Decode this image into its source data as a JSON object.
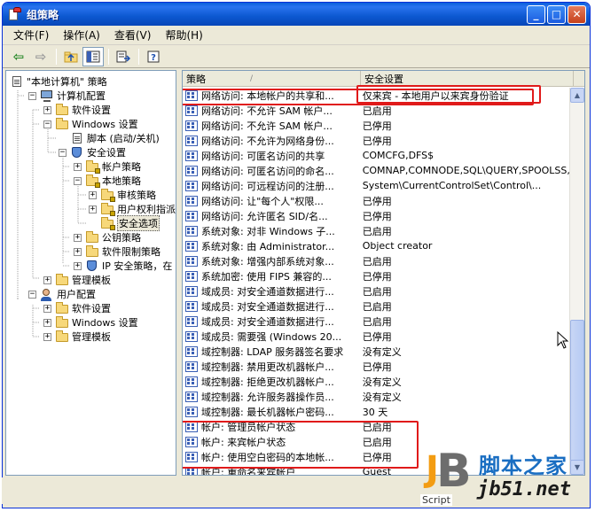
{
  "window": {
    "title": "组策略",
    "buttons": {
      "minimize": "_",
      "maximize": "□",
      "close": "✕"
    }
  },
  "menubar": {
    "items": [
      {
        "label": "文件(F)"
      },
      {
        "label": "操作(A)"
      },
      {
        "label": "查看(V)"
      },
      {
        "label": "帮助(H)"
      }
    ]
  },
  "toolbar": {
    "back_icon": "arrow-left-icon",
    "forward_icon": "arrow-right-icon",
    "up_icon": "up-folder-icon",
    "show_hide_tree_icon": "tree-toggle-icon",
    "export_icon": "export-list-icon",
    "help_icon": "help-icon"
  },
  "tree": {
    "items": [
      {
        "label": "\"本地计算机\" 策略",
        "icon": "policy-icon",
        "expander": "",
        "indent": 0
      },
      {
        "label": "计算机配置",
        "icon": "computer-icon",
        "expander": "−",
        "indent": 1
      },
      {
        "label": "软件设置",
        "icon": "folder-icon",
        "expander": "+",
        "indent": 2
      },
      {
        "label": "Windows 设置",
        "icon": "folder-icon",
        "expander": "−",
        "indent": 2
      },
      {
        "label": "脚本 (启动/关机)",
        "icon": "script-icon",
        "expander": "",
        "indent": 3
      },
      {
        "label": "安全设置",
        "icon": "shield-icon",
        "expander": "−",
        "indent": 3
      },
      {
        "label": "帐户策略",
        "icon": "locked-folder-icon",
        "expander": "+",
        "indent": 4
      },
      {
        "label": "本地策略",
        "icon": "locked-folder-icon",
        "expander": "−",
        "indent": 4
      },
      {
        "label": "审核策略",
        "icon": "locked-folder-icon",
        "expander": "+",
        "indent": 5
      },
      {
        "label": "用户权利指派",
        "icon": "locked-folder-icon",
        "expander": "+",
        "indent": 5
      },
      {
        "label": "安全选项",
        "icon": "locked-folder-icon",
        "expander": "",
        "indent": 5,
        "selected": true
      },
      {
        "label": "公钥策略",
        "icon": "folder-icon",
        "expander": "+",
        "indent": 4
      },
      {
        "label": "软件限制策略",
        "icon": "folder-icon",
        "expander": "+",
        "indent": 4
      },
      {
        "label": "IP 安全策略，在",
        "icon": "ip-security-icon",
        "expander": "+",
        "indent": 4
      },
      {
        "label": "管理模板",
        "icon": "folder-icon",
        "expander": "+",
        "indent": 2
      },
      {
        "label": "用户配置",
        "icon": "user-icon",
        "expander": "−",
        "indent": 1
      },
      {
        "label": "软件设置",
        "icon": "folder-icon",
        "expander": "+",
        "indent": 2
      },
      {
        "label": "Windows 设置",
        "icon": "folder-icon",
        "expander": "+",
        "indent": 2
      },
      {
        "label": "管理模板",
        "icon": "folder-icon",
        "expander": "+",
        "indent": 2
      }
    ]
  },
  "list": {
    "columns": [
      {
        "label": "策略",
        "sort": "/"
      },
      {
        "label": "安全设置"
      }
    ],
    "rows": [
      {
        "policy": "网络访问: 本地帐户的共享和...",
        "setting": "仅来宾 - 本地用户以来宾身份验证"
      },
      {
        "policy": "网络访问: 不允许 SAM 帐户...",
        "setting": "已启用"
      },
      {
        "policy": "网络访问: 不允许 SAM 帐户...",
        "setting": "已停用"
      },
      {
        "policy": "网络访问: 不允许为网络身份...",
        "setting": "已停用"
      },
      {
        "policy": "网络访问: 可匿名访问的共享",
        "setting": "COMCFG,DFS$"
      },
      {
        "policy": "网络访问: 可匿名访问的命名...",
        "setting": "COMNAP,COMNODE,SQL\\QUERY,SPOOLSS,..."
      },
      {
        "policy": "网络访问: 可远程访问的注册...",
        "setting": "System\\CurrentControlSet\\Control\\..."
      },
      {
        "policy": "网络访问: 让\"每个人\"权限...",
        "setting": "已停用"
      },
      {
        "policy": "网络访问: 允许匿名 SID/名...",
        "setting": "已停用"
      },
      {
        "policy": "系统对象: 对非 Windows 子...",
        "setting": "已启用"
      },
      {
        "policy": "系统对象: 由 Administrator...",
        "setting": "Object creator"
      },
      {
        "policy": "系统对象: 增强内部系统对象...",
        "setting": "已启用"
      },
      {
        "policy": "系统加密: 使用 FIPS 兼容的...",
        "setting": "已停用"
      },
      {
        "policy": "域成员: 对安全通道数据进行...",
        "setting": "已启用"
      },
      {
        "policy": "域成员: 对安全通道数据进行...",
        "setting": "已启用"
      },
      {
        "policy": "域成员: 对安全通道数据进行...",
        "setting": "已启用"
      },
      {
        "policy": "域成员: 需要强 (Windows 20...",
        "setting": "已停用"
      },
      {
        "policy": "域控制器: LDAP 服务器签名要求",
        "setting": "没有定义"
      },
      {
        "policy": "域控制器: 禁用更改机器帐户...",
        "setting": "已停用"
      },
      {
        "policy": "域控制器: 拒绝更改机器帐户...",
        "setting": "没有定义"
      },
      {
        "policy": "域控制器: 允许服务器操作员...",
        "setting": "没有定义"
      },
      {
        "policy": "域控制器: 最长机器帐户密码...",
        "setting": "30 天"
      },
      {
        "policy": "帐户: 管理员帐户状态",
        "setting": "已启用"
      },
      {
        "policy": "帐户: 来宾帐户状态",
        "setting": "已启用"
      },
      {
        "policy": "帐户: 使用空白密码的本地帐...",
        "setting": "已停用"
      },
      {
        "policy": "帐户: 重命名来宾帐户",
        "setting": "Guest"
      }
    ]
  },
  "watermark": {
    "script_label": "Script",
    "site_cn": "脚本之家",
    "site_url": "jb51.net",
    "logo_letters": "JB"
  },
  "colors": {
    "titlebar": "#0a5fd9",
    "annotation": "#e01a1a",
    "watermark_text": "#1a6ec2"
  }
}
